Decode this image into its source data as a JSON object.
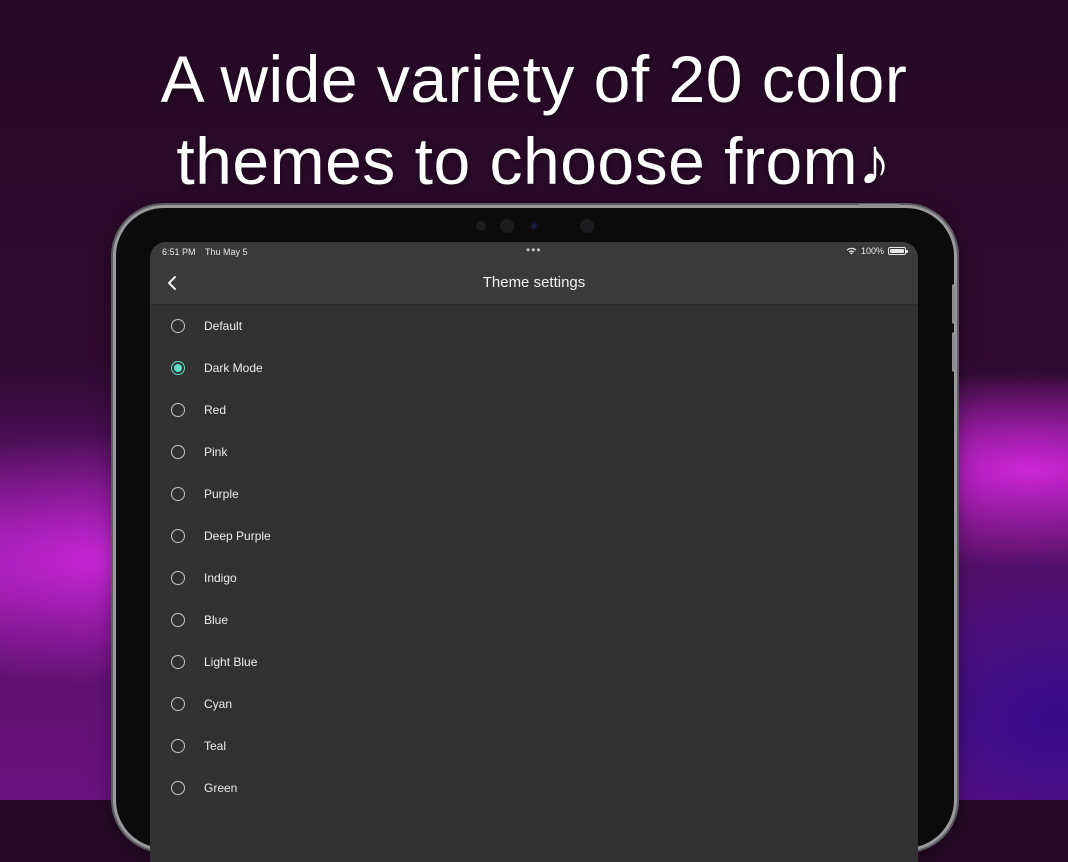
{
  "headline": {
    "line1": "A wide variety of 20 color",
    "line2": "themes to choose from♪"
  },
  "status_bar": {
    "time": "6:51 PM",
    "date": "Thu May 5",
    "dots": "•••",
    "battery": "100%"
  },
  "nav": {
    "title": "Theme settings",
    "back_icon": "chevron-left-icon"
  },
  "colors": {
    "background_dark": "#2d0a2d",
    "screen_bg": "#313131",
    "bar_bg": "#3a3a3a",
    "accent": "#5fe0c8"
  },
  "selected_theme": "Dark Mode",
  "themes": [
    {
      "label": "Default",
      "selected": false
    },
    {
      "label": "Dark Mode",
      "selected": true
    },
    {
      "label": "Red",
      "selected": false
    },
    {
      "label": "Pink",
      "selected": false
    },
    {
      "label": "Purple",
      "selected": false
    },
    {
      "label": "Deep Purple",
      "selected": false
    },
    {
      "label": "Indigo",
      "selected": false
    },
    {
      "label": "Blue",
      "selected": false
    },
    {
      "label": "Light Blue",
      "selected": false
    },
    {
      "label": "Cyan",
      "selected": false
    },
    {
      "label": "Teal",
      "selected": false
    },
    {
      "label": "Green",
      "selected": false
    }
  ]
}
